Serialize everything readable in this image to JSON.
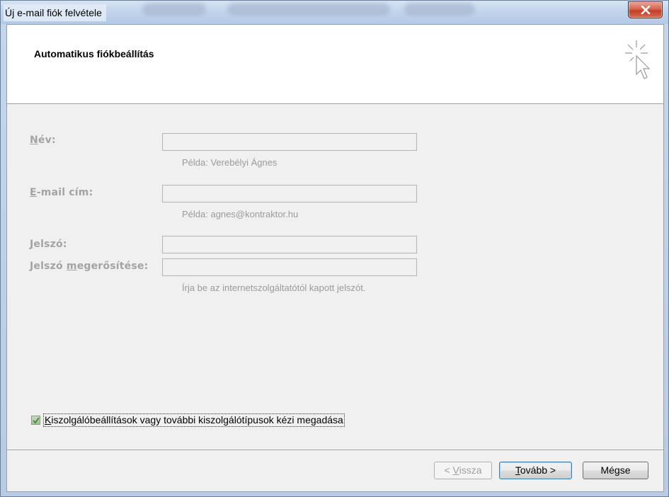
{
  "window": {
    "title": "Új e-mail fiók felvétele"
  },
  "header": {
    "title": "Automatikus fiókbeállítás"
  },
  "form": {
    "name": {
      "label_ul": "N",
      "label_rest": "év:",
      "value": "",
      "hint": "Példa: Verebélyi Ágnes"
    },
    "email": {
      "label_ul": "E",
      "label_rest": "-mail cím:",
      "value": "",
      "hint": "Példa: agnes@kontraktor.hu"
    },
    "password": {
      "label_ul": "J",
      "label_rest": "elszó:",
      "value": ""
    },
    "password_confirm": {
      "label_pre": "Jelszó ",
      "label_ul": "m",
      "label_rest": "egerősítése:",
      "value": "",
      "hint": "Írja be az internetszolgáltatótól kapott jelszót."
    }
  },
  "manual_setup": {
    "label_ul": "K",
    "label_rest": "iszolgálóbeállítások vagy további kiszolgálótípusok kézi megadása",
    "checked": true
  },
  "buttons": {
    "back": {
      "pre": "< ",
      "ul": "V",
      "rest": "issza"
    },
    "next": {
      "ul": "T",
      "rest": "ovább >"
    },
    "cancel": {
      "label": "Mégse"
    }
  },
  "colors": {
    "accent": "#3c7fb1",
    "close": "#c2402a",
    "disabled_text": "#a3a3a3"
  }
}
